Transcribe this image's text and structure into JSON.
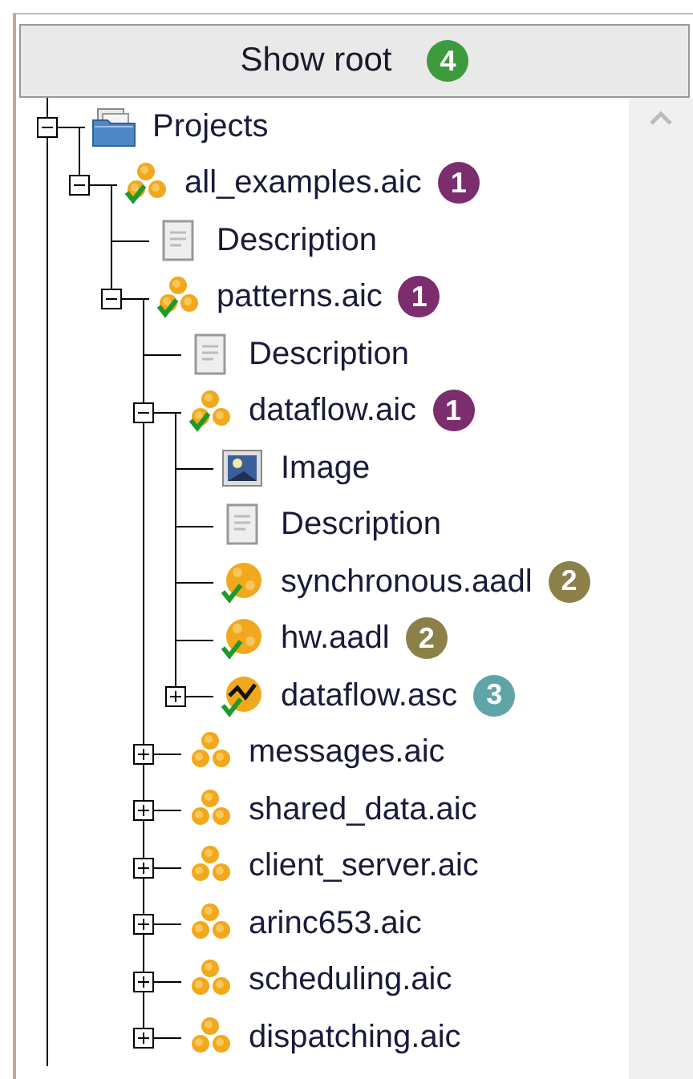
{
  "button": {
    "label": "Show root",
    "badge": {
      "text": "4",
      "color": "#3d9a3d"
    }
  },
  "tree": [
    {
      "label": "Projects",
      "kind": "folder",
      "expanded": true,
      "children": [
        {
          "label": "all_examples.aic",
          "kind": "package",
          "verified": true,
          "expanded": true,
          "badge": {
            "text": "1",
            "color": "#7b2d6e"
          },
          "children": [
            {
              "label": "Description",
              "kind": "description"
            },
            {
              "label": "patterns.aic",
              "kind": "package",
              "verified": true,
              "expanded": true,
              "badge": {
                "text": "1",
                "color": "#7b2d6e"
              },
              "children": [
                {
                  "label": "Description",
                  "kind": "description"
                },
                {
                  "label": "dataflow.aic",
                  "kind": "package",
                  "verified": true,
                  "expanded": true,
                  "badge": {
                    "text": "1",
                    "color": "#7b2d6e"
                  },
                  "children": [
                    {
                      "label": "Image",
                      "kind": "image"
                    },
                    {
                      "label": "Description",
                      "kind": "description"
                    },
                    {
                      "label": "synchronous.aadl",
                      "kind": "aadl",
                      "verified": true,
                      "badge": {
                        "text": "2",
                        "color": "#8b8048"
                      }
                    },
                    {
                      "label": "hw.aadl",
                      "kind": "aadl",
                      "verified": true,
                      "badge": {
                        "text": "2",
                        "color": "#8b8048"
                      }
                    },
                    {
                      "label": "dataflow.asc",
                      "kind": "asc",
                      "verified": true,
                      "expanded": false,
                      "badge": {
                        "text": "3",
                        "color": "#5fa5a8"
                      }
                    }
                  ]
                },
                {
                  "label": "messages.aic",
                  "kind": "package",
                  "verified": false,
                  "expanded": false
                },
                {
                  "label": "shared_data.aic",
                  "kind": "package",
                  "verified": false,
                  "expanded": false
                },
                {
                  "label": "client_server.aic",
                  "kind": "package",
                  "verified": false,
                  "expanded": false
                },
                {
                  "label": "arinc653.aic",
                  "kind": "package",
                  "verified": false,
                  "expanded": false
                },
                {
                  "label": "scheduling.aic",
                  "kind": "package",
                  "verified": false,
                  "expanded": false
                },
                {
                  "label": "dispatching.aic",
                  "kind": "package",
                  "verified": false,
                  "expanded": false
                }
              ]
            }
          ]
        }
      ]
    }
  ]
}
